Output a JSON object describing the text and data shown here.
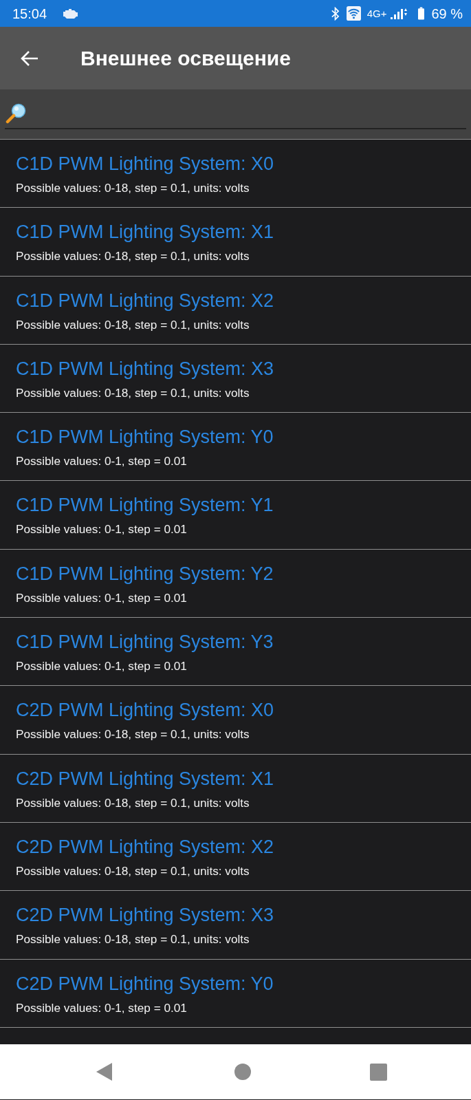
{
  "status_bar": {
    "time": "15:04",
    "network": "4G+",
    "battery": "69 %"
  },
  "app_bar": {
    "title": "Внешнее освещение"
  },
  "items": [
    {
      "title": "C1D PWM Lighting System: X0",
      "subtitle": "Possible values: 0-18, step = 0.1, units: volts"
    },
    {
      "title": "C1D PWM Lighting System: X1",
      "subtitle": "Possible values: 0-18, step = 0.1, units: volts"
    },
    {
      "title": "C1D PWM Lighting System: X2",
      "subtitle": "Possible values: 0-18, step = 0.1, units: volts"
    },
    {
      "title": "C1D PWM Lighting System: X3",
      "subtitle": "Possible values: 0-18, step = 0.1, units: volts"
    },
    {
      "title": "C1D PWM Lighting System: Y0",
      "subtitle": "Possible values: 0-1, step = 0.01"
    },
    {
      "title": "C1D PWM Lighting System: Y1",
      "subtitle": "Possible values: 0-1, step = 0.01"
    },
    {
      "title": "C1D PWM Lighting System: Y2",
      "subtitle": "Possible values: 0-1, step = 0.01"
    },
    {
      "title": "C1D PWM Lighting System: Y3",
      "subtitle": "Possible values: 0-1, step = 0.01"
    },
    {
      "title": "C2D PWM Lighting System: X0",
      "subtitle": "Possible values: 0-18, step = 0.1, units: volts"
    },
    {
      "title": "C2D PWM Lighting System: X1",
      "subtitle": "Possible values: 0-18, step = 0.1, units: volts"
    },
    {
      "title": "C2D PWM Lighting System: X2",
      "subtitle": "Possible values: 0-18, step = 0.1, units: volts"
    },
    {
      "title": "C2D PWM Lighting System: X3",
      "subtitle": "Possible values: 0-18, step = 0.1, units: volts"
    },
    {
      "title": "C2D PWM Lighting System: Y0",
      "subtitle": "Possible values: 0-1, step = 0.01"
    }
  ]
}
